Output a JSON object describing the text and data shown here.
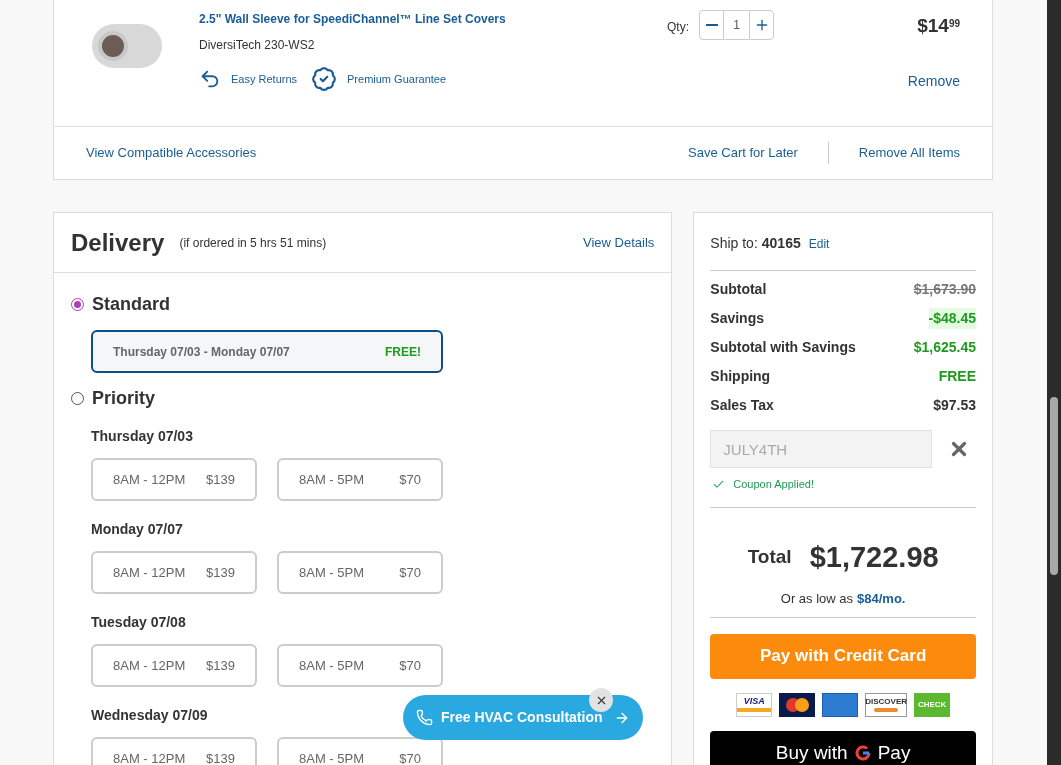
{
  "cart_item": {
    "title": "2.5\" Wall Sleeve for SpeediChannel™ Line Set Covers",
    "sku": "DiversiTech 230-WS2",
    "badges": [
      {
        "kind": "returns",
        "label": "Easy Returns"
      },
      {
        "kind": "guarantee",
        "label": "Premium Guarantee"
      }
    ],
    "qty_label": "Qty:",
    "qty": "1",
    "price_dollars": "$14",
    "price_cents": "99",
    "remove": "Remove"
  },
  "cart_actions": {
    "accessories": "View Compatible Accessories",
    "save": "Save Cart for Later",
    "remove_all": "Remove All Items"
  },
  "delivery": {
    "title": "Delivery",
    "note": "(if ordered in 5 hrs 51 mins)",
    "view_details": "View Details",
    "options": [
      {
        "kind": "standard",
        "label": "Standard",
        "selected": true,
        "range": "Thursday 07/03 - Monday 07/07",
        "price": "FREE!"
      },
      {
        "kind": "priority",
        "label": "Priority",
        "selected": false,
        "days": [
          {
            "date": "Thursday 07/03",
            "slots": [
              {
                "time": "8AM - 12PM",
                "price": "$139"
              },
              {
                "time": "8AM - 5PM",
                "price": "$70"
              }
            ]
          },
          {
            "date": "Monday 07/07",
            "slots": [
              {
                "time": "8AM - 12PM",
                "price": "$139"
              },
              {
                "time": "8AM - 5PM",
                "price": "$70"
              }
            ]
          },
          {
            "date": "Tuesday 07/08",
            "slots": [
              {
                "time": "8AM - 12PM",
                "price": "$139"
              },
              {
                "time": "8AM - 5PM",
                "price": "$70"
              }
            ]
          },
          {
            "date": "Wednesday 07/09",
            "slots": [
              {
                "time": "8AM - 12PM",
                "price": "$139"
              },
              {
                "time": "8AM - 5PM",
                "price": "$70"
              }
            ]
          }
        ]
      }
    ]
  },
  "summary": {
    "ship_to_label": "Ship to:",
    "zip": "40165",
    "edit": "Edit",
    "rows": [
      {
        "label": "Subtotal",
        "value": "$1,673.90",
        "kind": "struck"
      },
      {
        "label": "Savings",
        "value": "-$48.45",
        "kind": "savings"
      },
      {
        "label": "Subtotal with Savings",
        "value": "$1,625.45",
        "kind": "green"
      },
      {
        "label": "Shipping",
        "value": "FREE",
        "kind": "green"
      },
      {
        "label": "Sales Tax",
        "value": "$97.53",
        "kind": "plain"
      }
    ],
    "coupon": {
      "value": "JULY4TH",
      "disabled": true,
      "status": "Coupon Applied!"
    },
    "total_label": "Total",
    "total": "$1,722.98",
    "financing_prefix": "Or as low as",
    "financing_amount": "$84/mo.",
    "pay_button": "Pay with Credit Card",
    "payment_methods": [
      {
        "kind": "visa",
        "label": "VISA"
      },
      {
        "kind": "mastercard"
      },
      {
        "kind": "amex"
      },
      {
        "kind": "discover",
        "label": "DISCOVER"
      },
      {
        "kind": "check",
        "label": "CHECK"
      }
    ],
    "gpay": {
      "label": "Buy with",
      "brand": "Pay"
    }
  },
  "floating_button": {
    "label": "Free HVAC Consultation"
  }
}
